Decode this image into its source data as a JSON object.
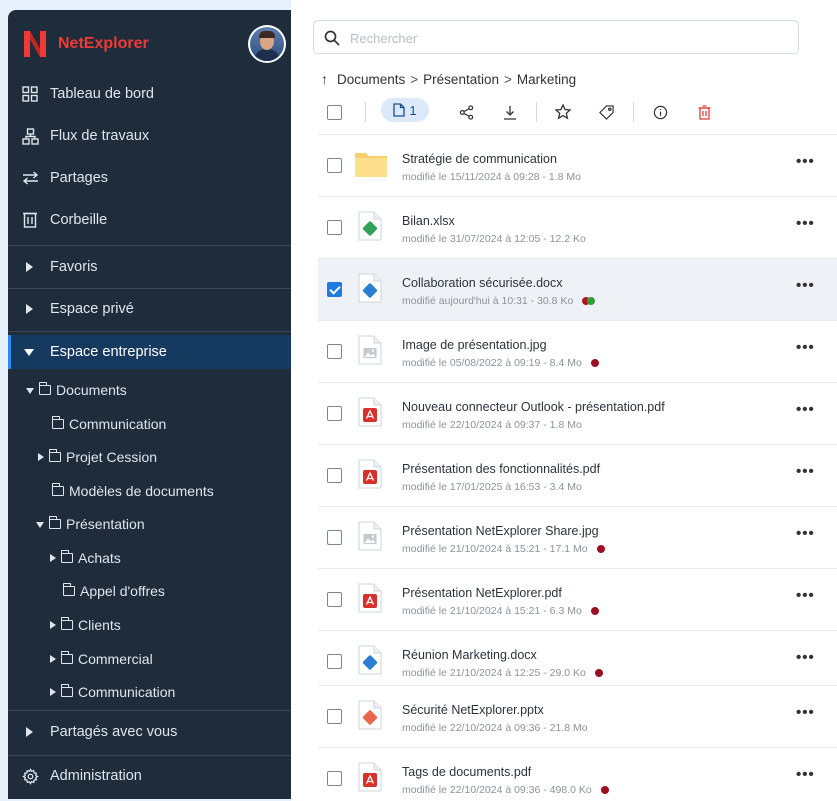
{
  "brand": {
    "name": "NetExplorer",
    "color": "#ef3b36"
  },
  "sidebar": {
    "nav": [
      {
        "label": "Tableau de bord",
        "icon": "dashboard-icon"
      },
      {
        "label": "Flux de travaux",
        "icon": "workflow-icon"
      },
      {
        "label": "Partages",
        "icon": "share-arrows-icon"
      },
      {
        "label": "Corbeille",
        "icon": "trash-icon"
      }
    ],
    "sections": {
      "favoris": "Favoris",
      "prive": "Espace privé",
      "entreprise": "Espace entreprise",
      "partages": "Partagés avec vous",
      "admin": "Administration"
    },
    "tree": [
      "Documents",
      "Communication",
      "Projet Cession",
      "Modèles de documents",
      "Présentation",
      "Achats",
      "Appel d'offres",
      "Clients",
      "Commercial",
      "Communication"
    ]
  },
  "search": {
    "placeholder": "Rechercher"
  },
  "breadcrumb": {
    "up": "↑",
    "items": [
      "Documents",
      "Présentation",
      "Marketing"
    ],
    "sep": ">"
  },
  "toolbar": {
    "selected_count": "1"
  },
  "files": [
    {
      "name": "Stratégie de communication",
      "meta": "modifié le 15/11/2024 à 09:28 - 1.8 Mo",
      "type": "folder",
      "tags": []
    },
    {
      "name": "Bilan.xlsx",
      "meta": "modifié le 31/07/2024 à 12:05 - 12.2 Ko",
      "type": "xlsx",
      "tags": []
    },
    {
      "name": "Collaboration sécurisée.docx",
      "meta": "modifié aujourd'hui à 10:31 - 30.8 Ko",
      "type": "docx",
      "tags": [
        "#b3141e",
        "#2e9e3b"
      ],
      "selected": true
    },
    {
      "name": "Image de présentation.jpg",
      "meta": "modifié le 05/08/2022 à 09:19 - 8.4 Mo",
      "type": "image",
      "tags": [
        "#9b1020"
      ]
    },
    {
      "name": "Nouveau connecteur Outlook - présentation.pdf",
      "meta": "modifié le 22/10/2024 à 09:37 - 1.8 Mo",
      "type": "pdf",
      "tags": []
    },
    {
      "name": "Présentation des fonctionnalités.pdf",
      "meta": "modifié le 17/01/2025 à 16:53 - 3.4 Mo",
      "type": "pdf",
      "tags": []
    },
    {
      "name": "Présentation NetExplorer Share.jpg",
      "meta": "modifié le 21/10/2024 à 15:21 - 17.1 Mo",
      "type": "image",
      "tags": [
        "#9b1020"
      ]
    },
    {
      "name": "Présentation NetExplorer.pdf",
      "meta": "modifié le 21/10/2024 à 15:21 - 6.3 Mo",
      "type": "pdf",
      "tags": [
        "#9b1020"
      ]
    },
    {
      "name": "Réunion Marketing.docx",
      "meta": "modifié le 21/10/2024 à 12:25 - 29.0 Ko",
      "type": "docx",
      "tags": [
        "#9b1020"
      ]
    },
    {
      "name": "Sécurité NetExplorer.pptx",
      "meta": "modifié le 22/10/2024 à 09:36 - 21.8 Mo",
      "type": "pptx",
      "tags": []
    },
    {
      "name": "Tags de documents.pdf",
      "meta": "modifié le 22/10/2024 à 09:36 - 498.0 Ko",
      "type": "pdf",
      "tags": [
        "#9b1020"
      ]
    }
  ],
  "more_label": "•••"
}
